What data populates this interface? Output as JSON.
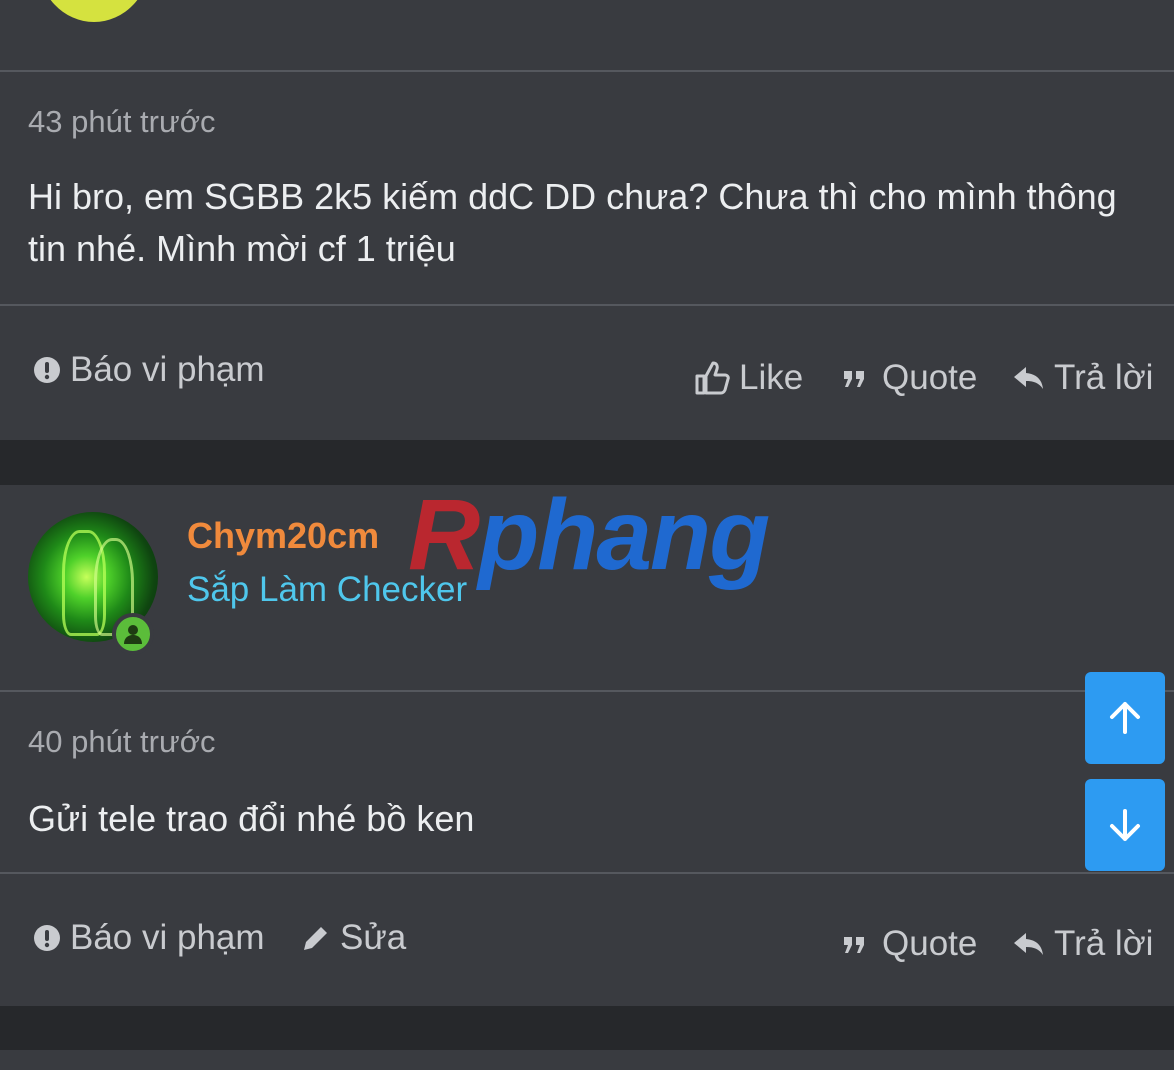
{
  "post1": {
    "time": "43 phút trước",
    "message": "Hi bro, em SGBB 2k5 kiếm ddC DD chưa? Chưa thì cho mình thông tin nhé. Mình mời cf 1 triệu",
    "actions": {
      "report": "Báo vi phạm",
      "like": "Like",
      "quote": "Quote",
      "reply": "Trả lời"
    }
  },
  "post2": {
    "username": "Chym20cm",
    "user_title": "Sắp Làm Checker",
    "time": "40 phút trước",
    "message": "Gửi tele trao đổi nhé bồ ken",
    "actions": {
      "report": "Báo vi phạm",
      "edit": "Sửa",
      "quote": "Quote",
      "reply": "Trả lời"
    }
  },
  "watermark": {
    "r": "R",
    "rest": "phang"
  },
  "colors": {
    "background": "#26282b",
    "panel": "#393b40",
    "username": "#f08a3c",
    "user_title": "#4fc7ec",
    "scroll_button": "#2d9bf2",
    "online": "#5bbd3a"
  }
}
